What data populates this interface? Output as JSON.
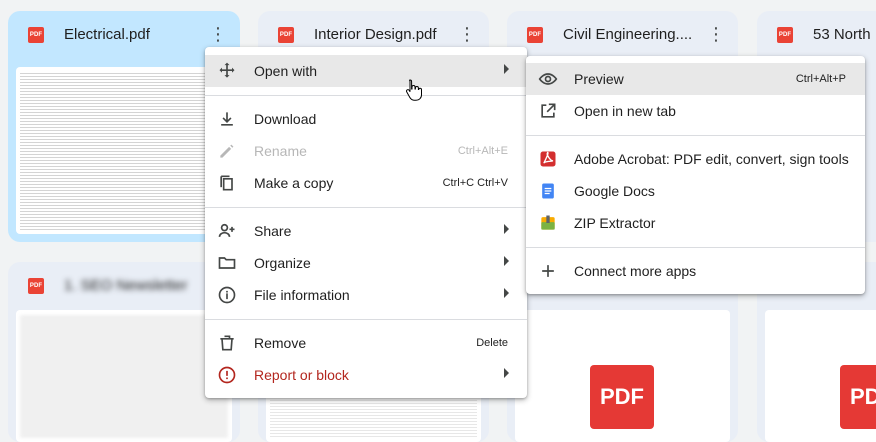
{
  "files": [
    {
      "name": "Electrical.pdf",
      "type_badge": "PDF",
      "selected": true
    },
    {
      "name": "Interior Design.pdf",
      "type_badge": "PDF"
    },
    {
      "name": "Civil Engineering....",
      "type_badge": "PDF"
    },
    {
      "name": "53 North",
      "type_badge": "PDF"
    },
    {
      "name": "1. SEO Newsletter",
      "type_badge": "PDF"
    }
  ],
  "big_pdf_label": "PDF",
  "context_menu": {
    "items": [
      {
        "label": "Open with",
        "icon": "move-arrows-icon",
        "submenu": true,
        "highlighted": true
      },
      {
        "label": "Download",
        "icon": "download-icon"
      },
      {
        "label": "Rename",
        "icon": "pencil-icon",
        "shortcut": "Ctrl+Alt+E",
        "disabled": true
      },
      {
        "label": "Make a copy",
        "icon": "copy-icon",
        "shortcut": "Ctrl+C Ctrl+V"
      },
      {
        "label": "Share",
        "icon": "person-add-icon",
        "submenu": true
      },
      {
        "label": "Organize",
        "icon": "folder-icon",
        "submenu": true
      },
      {
        "label": "File information",
        "icon": "info-icon",
        "submenu": true
      },
      {
        "label": "Remove",
        "icon": "trash-icon",
        "shortcut": "Delete"
      },
      {
        "label": "Report or block",
        "icon": "alert-icon",
        "submenu": true,
        "danger": true
      }
    ]
  },
  "open_with_menu": {
    "items": [
      {
        "label": "Preview",
        "icon": "eye-icon",
        "shortcut": "Ctrl+Alt+P",
        "highlighted": true
      },
      {
        "label": "Open in new tab",
        "icon": "open-new-tab-icon"
      },
      {
        "label": "Adobe Acrobat: PDF edit, convert, sign tools",
        "icon": "adobe-acrobat-icon"
      },
      {
        "label": "Google Docs",
        "icon": "google-docs-icon"
      },
      {
        "label": "ZIP Extractor",
        "icon": "zip-extractor-icon"
      },
      {
        "label": "Connect more apps",
        "icon": "plus-icon"
      }
    ]
  },
  "colors": {
    "selected_card": "#c2e7ff",
    "pdf_red": "#ea4335",
    "danger": "#b3261e",
    "docs_blue": "#4285f4"
  }
}
